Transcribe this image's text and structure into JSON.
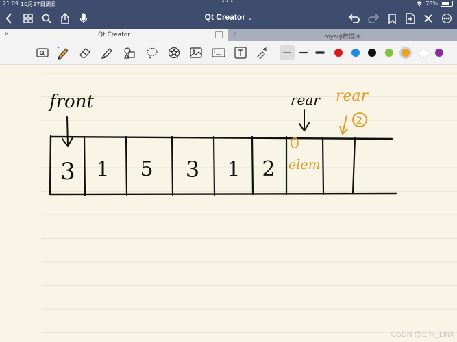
{
  "status": {
    "time": "21:09",
    "date": "10月27日周日",
    "dots": "•••",
    "battery": "78%",
    "battery_level": 0.78
  },
  "app": {
    "title": "Qt  Creator",
    "title_chevron": "⌄"
  },
  "tabs": [
    {
      "label": "Qt  Creator",
      "active": true,
      "close": "×"
    },
    {
      "label": "mysql数据库",
      "active": false,
      "close": "×"
    }
  ],
  "toolbar": {
    "tools": [
      "reader-mode-icon",
      "pen-icon",
      "eraser-icon",
      "highlighter-icon",
      "shapes-icon",
      "lasso-icon",
      "sticker-icon",
      "image-icon",
      "keyboard-icon",
      "text-box-icon",
      "laser-pointer-icon"
    ],
    "colors": [
      "#d81b1b",
      "#1e88e5",
      "#111111",
      "#7cc23a",
      "#f0a025",
      "#ffffff",
      "#8e2a9a"
    ],
    "selected_color": "#f0a025",
    "selected_width": 0
  },
  "note": {
    "front_label": "front",
    "rear_label": "rear",
    "rear_new_label": "rear",
    "cells": [
      "3",
      "1",
      "5",
      "3",
      "1",
      "2"
    ],
    "new_element": "elem",
    "step1": "1",
    "step2": "2",
    "ink_color": "#111111",
    "annotation_color": "#e69a25"
  },
  "watermark": "CSDN @Erik_LinX"
}
